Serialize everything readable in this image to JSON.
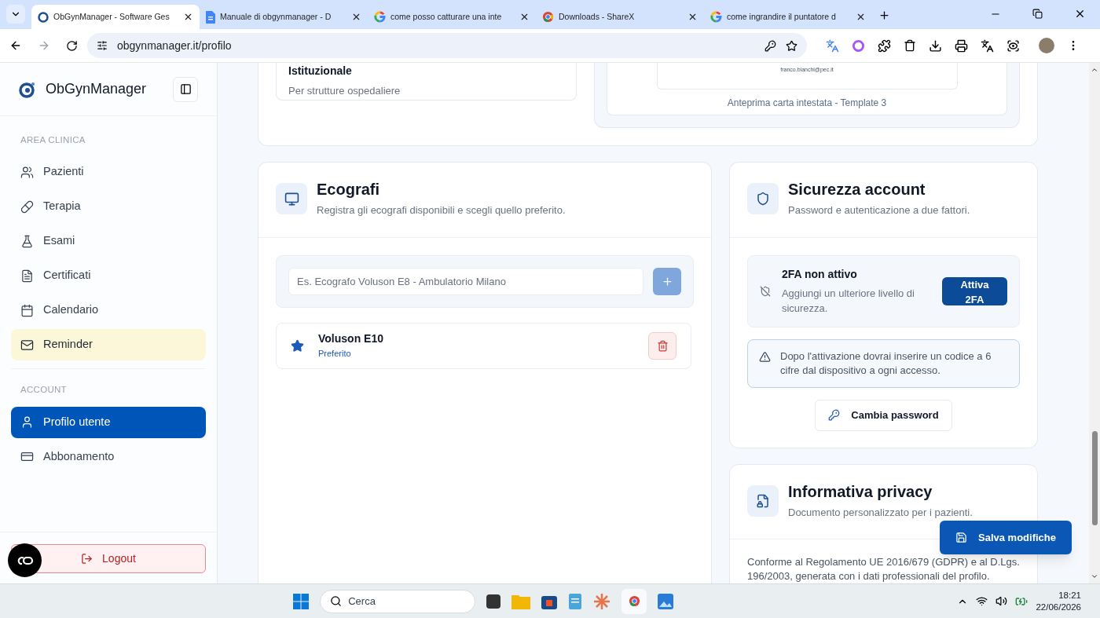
{
  "browser": {
    "tabs": [
      {
        "title": "ObGynManager - Software Ges",
        "kind": "app",
        "selected": true
      },
      {
        "title": "Manuale di obgynmanager - D",
        "kind": "doc",
        "selected": false
      },
      {
        "title": "come posso catturare una inte",
        "kind": "search",
        "selected": false
      },
      {
        "title": "Downloads - ShareX",
        "kind": "browser",
        "selected": false
      },
      {
        "title": "come ingrandire il puntatore d",
        "kind": "search",
        "selected": false
      }
    ],
    "url": "obgynmanager.it/profilo"
  },
  "sidebar": {
    "brand": "ObGynManager",
    "sections": [
      {
        "heading": "AREA CLINICA",
        "items": [
          {
            "label": "Pazienti",
            "kind": "patients",
            "selected": false,
            "highlighted": false
          },
          {
            "label": "Terapia",
            "kind": "therapy",
            "selected": false,
            "highlighted": false
          },
          {
            "label": "Esami",
            "kind": "exams",
            "selected": false,
            "highlighted": false
          },
          {
            "label": "Certificati",
            "kind": "certificates",
            "selected": false,
            "highlighted": false
          },
          {
            "label": "Calendario",
            "kind": "calendar",
            "selected": false,
            "highlighted": false
          },
          {
            "label": "Reminder",
            "kind": "reminder",
            "selected": false,
            "highlighted": true
          }
        ]
      },
      {
        "heading": "ACCOUNT",
        "items": [
          {
            "label": "Profilo utente",
            "kind": "profile",
            "selected": true,
            "highlighted": false
          },
          {
            "label": "Abbonamento",
            "kind": "subscription",
            "selected": false,
            "highlighted": false
          }
        ]
      }
    ],
    "logout": "Logout"
  },
  "letterhead": {
    "option_title": "Istituzionale",
    "option_subtitle": "Per strutture ospedaliere",
    "preview_email": "franco.bianchi@pec.it",
    "preview_caption": "Anteprima carta intestata - Template 3"
  },
  "ultrasound": {
    "title": "Ecografi",
    "subtitle": "Registra gli ecografi disponibili e scegli quello preferito.",
    "input_placeholder": "Es. Ecografo Voluson E8 - Ambulatorio Milano",
    "items": [
      {
        "name": "Voluson E10",
        "badge": "Preferito",
        "favorite": true
      }
    ]
  },
  "security": {
    "title": "Sicurezza account",
    "subtitle": "Password e autenticazione a due fattori.",
    "status_title": "2FA non attivo",
    "status_text": "Aggiungi un ulteriore livello di sicurezza.",
    "enable_button": "Attiva 2FA",
    "notice": "Dopo l'attivazione dovrai inserire un codice a 6 cifre dal dispositivo a ogni accesso.",
    "password_button": "Cambia password"
  },
  "privacy": {
    "title": "Informativa privacy",
    "subtitle": "Documento personalizzato per i pazienti.",
    "text": "Conforme al Regolamento UE 2016/679 (GDPR) e al D.Lgs. 196/2003, generata con i dati professionali del profilo."
  },
  "save_button": "Salva modifiche",
  "taskbar": {
    "search_placeholder": "Cerca",
    "time": "18:21",
    "date": "22/06/2026"
  }
}
